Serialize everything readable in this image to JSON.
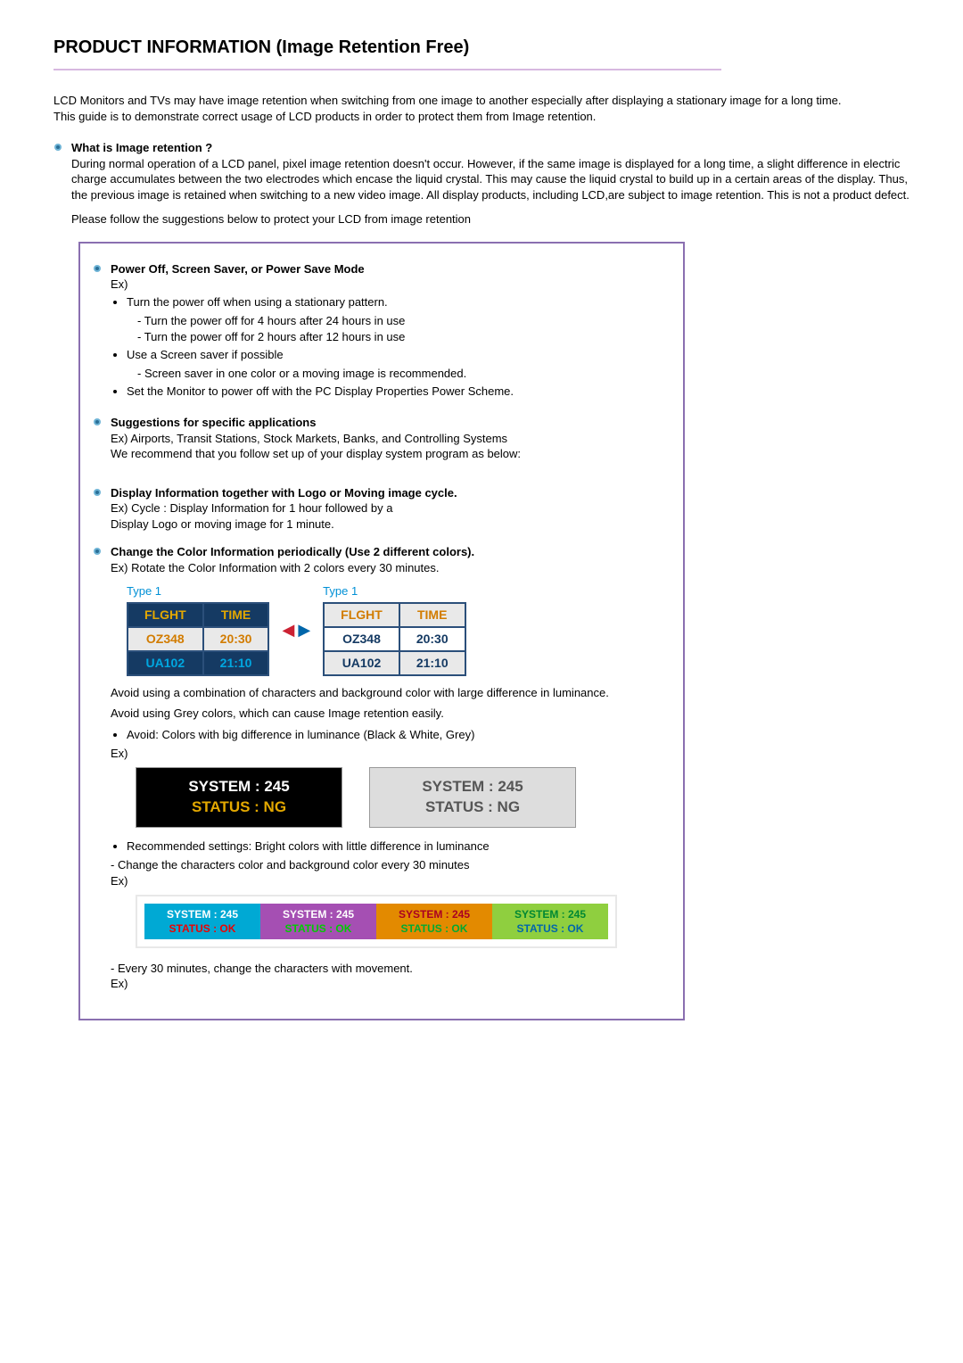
{
  "title": "PRODUCT INFORMATION (Image Retention Free)",
  "intro1": "LCD Monitors and TVs may have image retention when switching from one image to another especially after displaying a stationary image for a long time.",
  "intro2": "This guide is to demonstrate correct usage of LCD products in order to protect them from Image retention.",
  "q1": {
    "title": "What is Image retention ?",
    "body": "During normal operation of a LCD panel, pixel image retention doesn't occur. However, if the same image is displayed for a long time, a slight difference in electric charge accumulates between the two electrodes which encase the liquid crystal. This may cause the liquid crystal to build up in a certain areas of the display. Thus, the previous image is retained when switching to a new video image. All display products, including LCD,are subject to image retention. This is not a product defect.",
    "follow": "Please follow the suggestions below to protect your LCD from image retention"
  },
  "s1": {
    "title": "Power Off, Screen Saver, or Power Save Mode",
    "ex": "Ex)",
    "b1": "Turn the power off when using a stationary pattern.",
    "b1a": "- Turn the power off for 4 hours after 24 hours in use",
    "b1b": "- Turn the power off for 2 hours after 12 hours in use",
    "b2": "Use a Screen saver if possible",
    "b2a": "- Screen saver in one color or a moving image is recommended.",
    "b3": "Set the Monitor to power off with the PC Display Properties Power Scheme."
  },
  "s2": {
    "title": "Suggestions for specific applications",
    "l1": "Ex) Airports, Transit Stations, Stock Markets, Banks, and Controlling Systems",
    "l2": "We recommend that you follow set up of your display system program as below:"
  },
  "s3": {
    "title": "Display Information together with Logo or Moving image cycle.",
    "l1": "Ex) Cycle : Display Information for 1 hour followed by a",
    "l2": "Display Logo or moving image for 1 minute."
  },
  "s4": {
    "title": "Change the Color Information periodically (Use 2 different colors).",
    "l1": "Ex) Rotate the Color Information with 2 colors every 30 minutes."
  },
  "ft": {
    "cap1": "Type 1",
    "cap2": "Type 1",
    "h1": "FLGHT",
    "h2": "TIME",
    "r0c0": "OZ348",
    "r0c1": "20:30",
    "r1c0": "UA102",
    "r1c1": "21:10"
  },
  "avoid": {
    "p1": "Avoid using a combination of characters and background color with large difference in luminance.",
    "p2": "Avoid using Grey colors, which can cause Image retention easily.",
    "bul": "Avoid: Colors with big difference in luminance (Black & White, Grey)",
    "ex": "Ex)",
    "box_l1": "SYSTEM : 245",
    "box_l2": "STATUS : NG"
  },
  "rec": {
    "bul": "Recommended settings: Bright colors with little difference in luminance",
    "l1": "- Change the characters color and background color every 30 minutes",
    "ex": "Ex)",
    "box_l1": "SYSTEM : 245",
    "box_l2": "STATUS : OK"
  },
  "last": {
    "l1": "- Every 30 minutes, change the characters with movement.",
    "ex": "Ex)"
  }
}
